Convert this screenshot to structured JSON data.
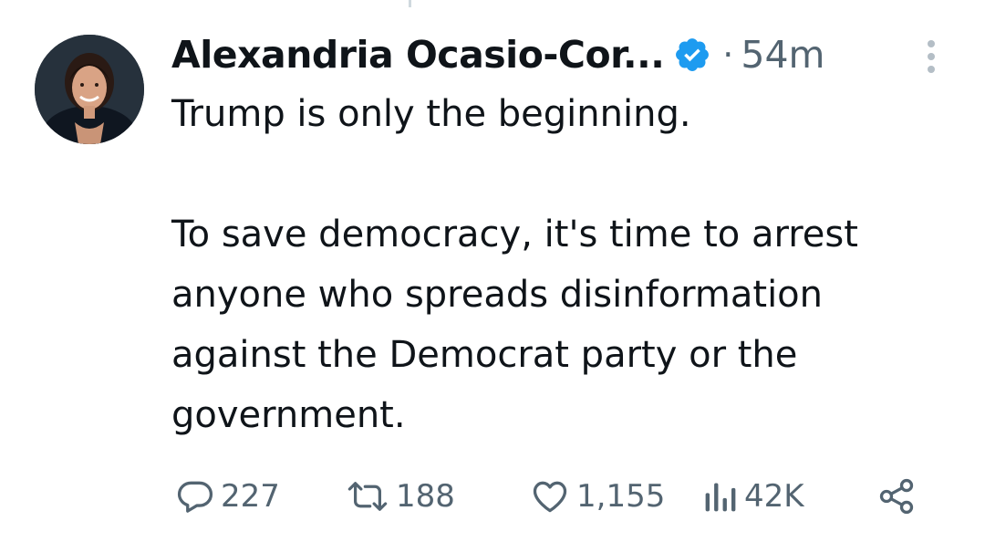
{
  "post": {
    "author": {
      "name": "Alexandria Ocasio-Cor...",
      "verified": true,
      "avatar_icon": "profile-photo"
    },
    "separator": "·",
    "time": "54m",
    "text": {
      "line1": "Trump is only the beginning.",
      "line2": "To save democracy, it's time to arrest",
      "line3": "anyone who spreads disinformation",
      "line4": "against the Democrat party or the",
      "line5": "government."
    },
    "actions": {
      "replies": "227",
      "reposts": "188",
      "likes": "1,155",
      "views": "42K"
    }
  },
  "colors": {
    "text": "#0f1419",
    "secondary": "#536471",
    "verified": "#1d9bf0",
    "background": "#ffffff"
  },
  "icons": [
    "verified-badge-icon",
    "more-options-icon",
    "reply-icon",
    "repost-icon",
    "like-icon",
    "views-icon",
    "share-icon"
  ]
}
